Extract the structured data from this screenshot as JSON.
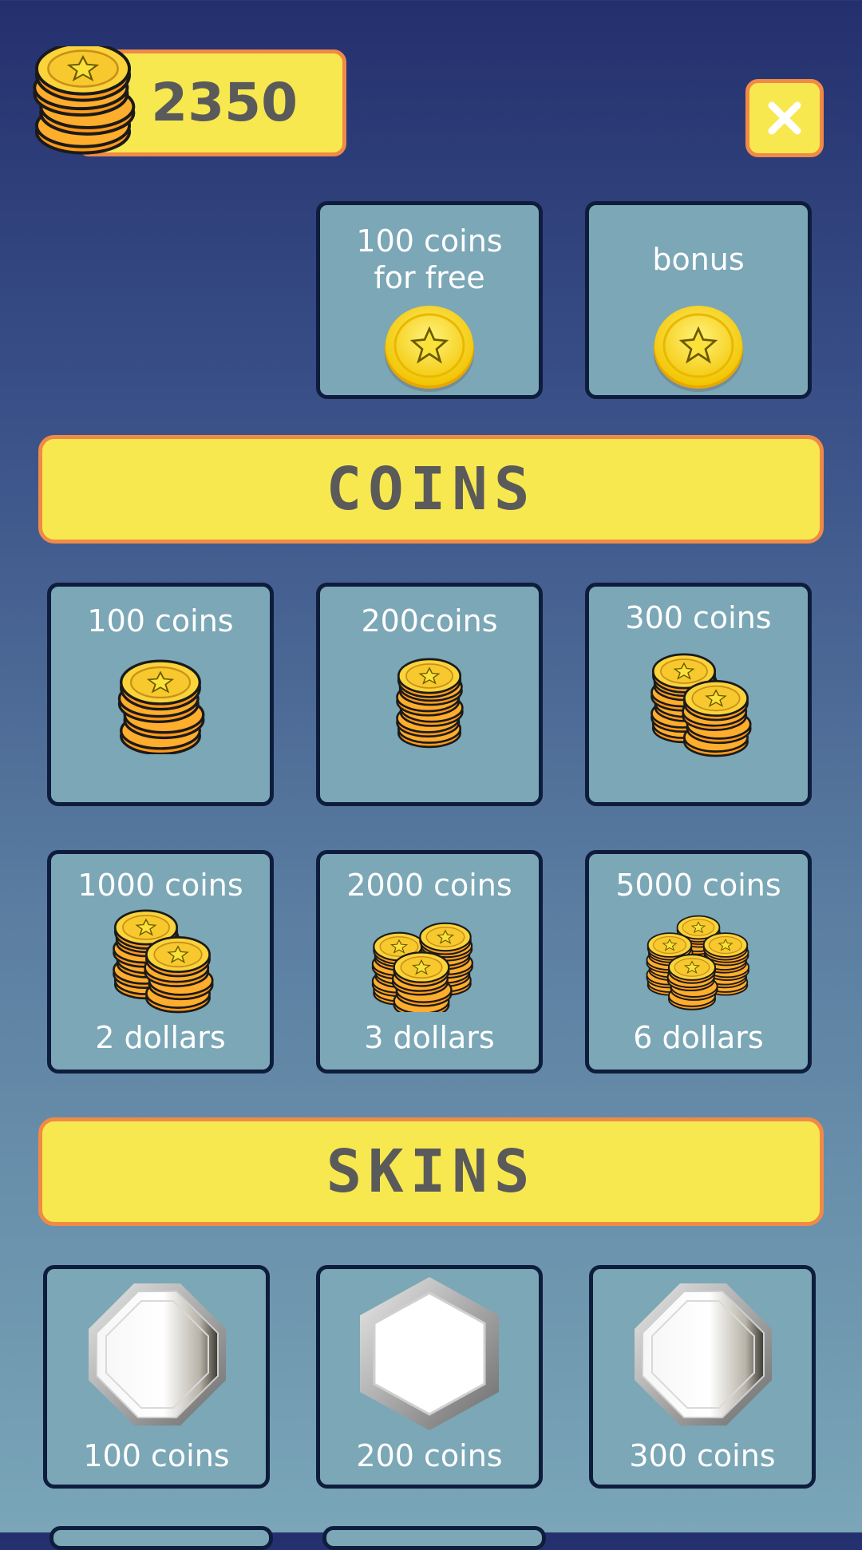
{
  "header": {
    "coin_balance": "2350",
    "close_icon": "close-icon"
  },
  "rewards": [
    {
      "label": "100 coins\nfor free",
      "icon": "coin-icon"
    },
    {
      "label": "bonus",
      "icon": "coin-icon"
    }
  ],
  "coins_section": {
    "title": "COINS",
    "items": [
      {
        "label": "100 coins",
        "icon": "coin-stack-icon"
      },
      {
        "label": "200coins",
        "icon": "coin-stack-icon"
      },
      {
        "label": "300 coins",
        "icon": "coin-stacks-icon"
      },
      {
        "label": "1000 coins",
        "price": "2 dollars",
        "icon": "coin-stacks-icon"
      },
      {
        "label": "2000 coins",
        "price": "3 dollars",
        "icon": "coin-pile-icon"
      },
      {
        "label": "5000 coins",
        "price": "6 dollars",
        "icon": "coin-pile-icon"
      }
    ]
  },
  "skins_section": {
    "title": "SKINS",
    "items": [
      {
        "label": "100 coins",
        "icon": "octagon-skin-icon"
      },
      {
        "label": "200 coins",
        "icon": "hexagon-skin-icon"
      },
      {
        "label": "300 coins",
        "icon": "octagon-skin-icon"
      }
    ]
  },
  "colors": {
    "accent_yellow": "#f7e850",
    "border_orange": "#f08a46",
    "card": "#7ba7b6",
    "card_border": "#0f1d3c",
    "text_dark": "#5a5a5a"
  }
}
